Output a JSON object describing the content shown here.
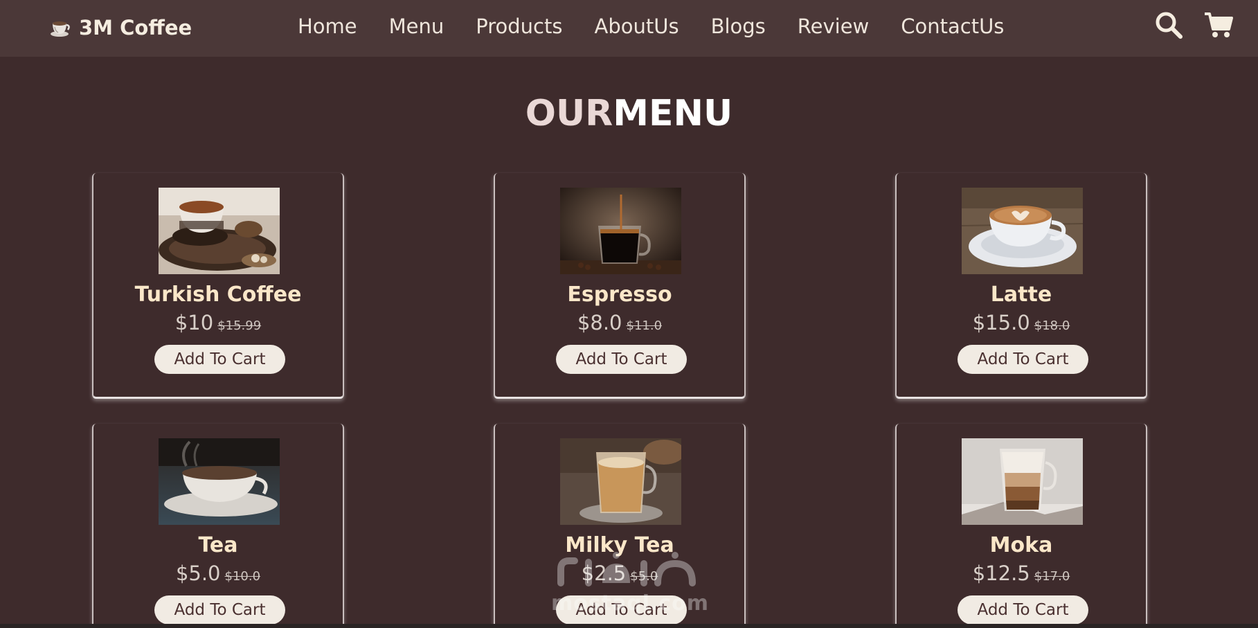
{
  "brand": {
    "name": "3M Coffee",
    "icon": "coffee-cup-icon"
  },
  "nav": {
    "links": [
      "Home",
      "Menu",
      "Products",
      "AboutUs",
      "Blogs",
      "Review",
      "ContactUs"
    ],
    "icons": [
      "search-icon",
      "cart-icon"
    ]
  },
  "menu": {
    "heading_part1": "OUR",
    "heading_part2": "MENU",
    "items": [
      {
        "name": "Turkish Coffee",
        "price": "$10",
        "old_price": "$15.99",
        "button": "Add To Cart"
      },
      {
        "name": "Espresso",
        "price": "$8.0",
        "old_price": "$11.0",
        "button": "Add To Cart"
      },
      {
        "name": "Latte",
        "price": "$15.0",
        "old_price": "$18.0",
        "button": "Add To Cart"
      },
      {
        "name": "Tea",
        "price": "$5.0",
        "old_price": "$10.0",
        "button": "Add To Cart"
      },
      {
        "name": "Milky Tea",
        "price": "$2.5",
        "old_price": "$5.0",
        "button": "Add To Cart"
      },
      {
        "name": "Moka",
        "price": "$12.5",
        "old_price": "$17.0",
        "button": "Add To Cart"
      }
    ]
  },
  "watermark": {
    "text": "mostaql.com"
  },
  "colors": {
    "background": "#3e2b2c",
    "navbar": "#4b3838",
    "item_name": "#fbe7c9",
    "button_bg": "#f1ebe3",
    "button_text": "#4a3030"
  }
}
